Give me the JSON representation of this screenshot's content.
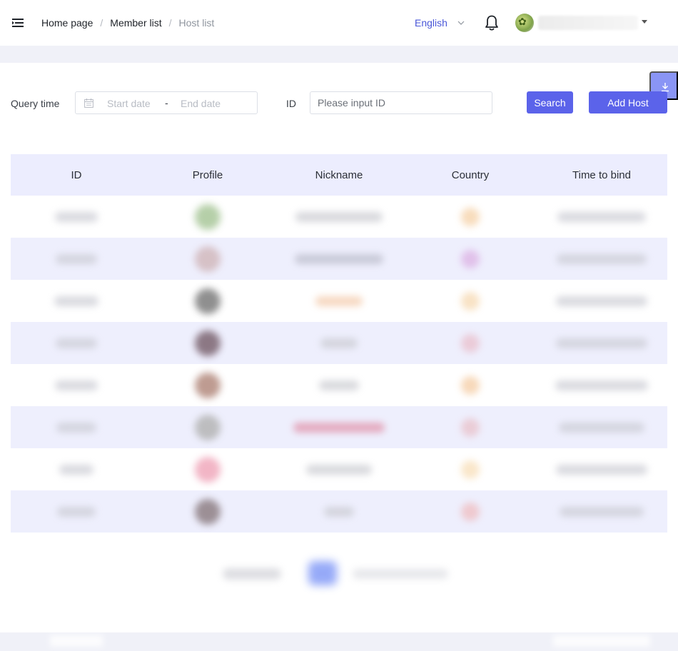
{
  "breadcrumb": {
    "home": "Home page",
    "members": "Member list",
    "current": "Host list",
    "separator": "/"
  },
  "header": {
    "language": "English"
  },
  "filters": {
    "query_time_label": "Query time",
    "start_placeholder": "Start date",
    "range_separator": "-",
    "end_placeholder": "End date",
    "id_label": "ID",
    "id_placeholder": "Please input ID",
    "search_label": "Search",
    "add_label": "Add Host"
  },
  "table": {
    "columns": [
      "ID",
      "Profile",
      "Nickname",
      "Country",
      "Time to bind"
    ],
    "avatar_colors": [
      "#a9c79a",
      "#d2b9bd",
      "#7c7c7c",
      "#7b6470",
      "#b38a7e",
      "#b5b5b5",
      "#f0a9bc",
      "#8e7f84"
    ],
    "country_colors": [
      "#f3c58f",
      "#d8a2dd",
      "#f4cf9e",
      "#e9b3bf",
      "#f2bf8c",
      "#e8b5bc",
      "#f6d6a6",
      "#f0b0b0"
    ],
    "nickname_colors": [
      "#c7c8ce",
      "#b9bac8",
      "#f3c8a7",
      "#c8c9cf",
      "#c8c9cf",
      "#e08ca4",
      "#c8c9cf",
      "#c8c9cf"
    ]
  }
}
